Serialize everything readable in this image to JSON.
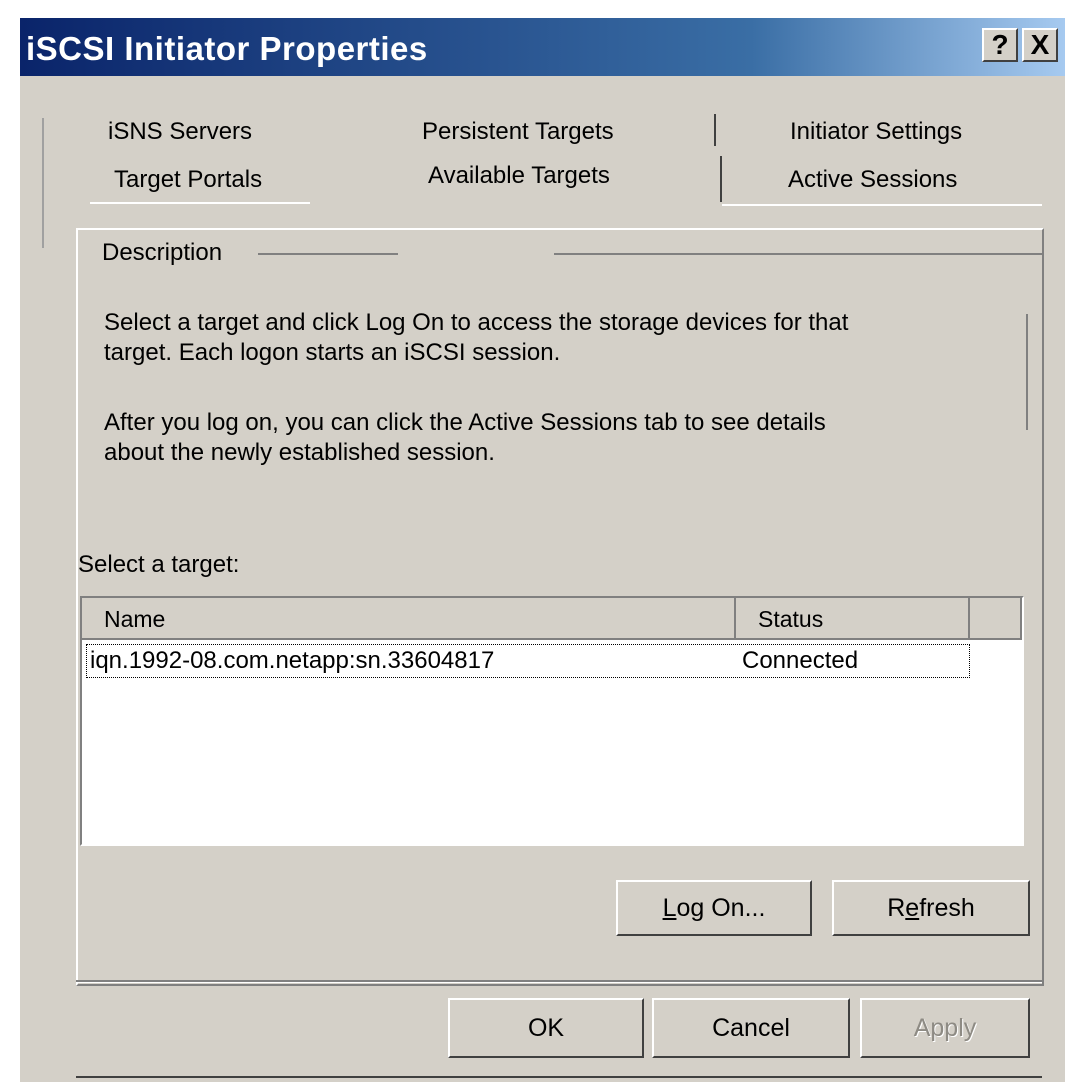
{
  "window": {
    "title": "iSCSI Initiator Properties",
    "help_label": "?",
    "close_label": "X"
  },
  "tabs": {
    "row1": [
      "iSNS Servers",
      "Persistent Targets",
      "Initiator Settings"
    ],
    "row2": [
      "Target Portals",
      "Available Targets",
      "Active Sessions"
    ],
    "selected": "Available Targets"
  },
  "description": {
    "group_label": "Description",
    "line1": "Select a target and click Log On to access the storage devices for that",
    "line2": "target. Each logon starts an iSCSI session.",
    "line3": "After you log on, you can click the Active Sessions tab to see details",
    "line4": "about the newly established session."
  },
  "targets": {
    "label": "Select a target:",
    "columns": [
      "Name",
      "Status"
    ],
    "rows": [
      {
        "name": "iqn.1992-08.com.netapp:sn.33604817",
        "status": "Connected"
      }
    ]
  },
  "buttons": {
    "logon_prefix": "",
    "logon_accel": "L",
    "logon_rest": "og On...",
    "refresh_prefix": "R",
    "refresh_accel": "e",
    "refresh_rest": "fresh",
    "ok": "OK",
    "cancel": "Cancel",
    "apply": "Apply"
  },
  "colors": {
    "face": "#d4d0c8",
    "title_start": "#0a246a",
    "title_end": "#a6caf0"
  }
}
